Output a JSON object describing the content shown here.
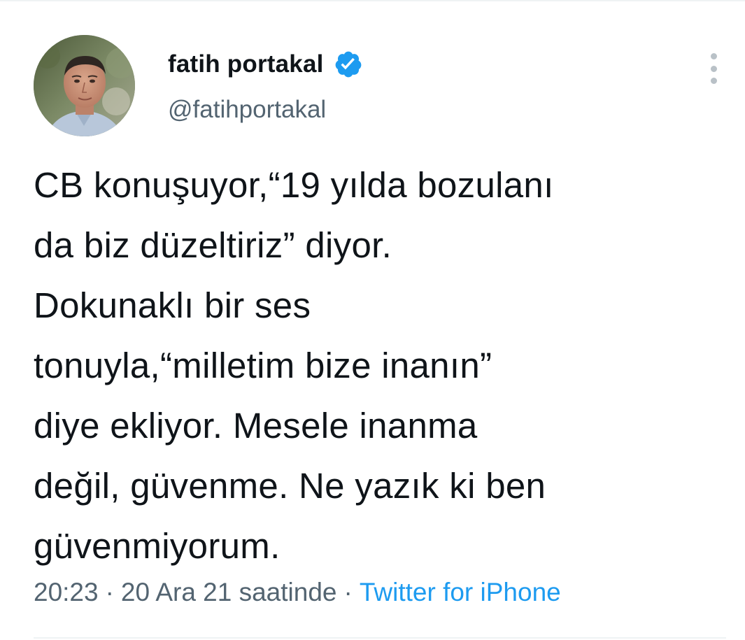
{
  "tweet": {
    "author": {
      "display_name": "fatih portakal",
      "handle": "@fatihportakal",
      "verified": true,
      "verified_icon": "verified-badge-icon",
      "avatar_icon": "avatar-photo"
    },
    "more_menu_icon": "more-vertical-icon",
    "text_lines": [
      "CB konuşuyor,“19 yılda bozulanı",
      "da biz düzeltiriz” diyor.",
      "Dokunaklı bir ses",
      "tonuyla,“milletim bize inanın”",
      "diye ekliyor. Mesele inanma",
      "değil, güvenme. Ne yazık ki ben",
      "güvenmiyorum."
    ],
    "meta": {
      "time": "20:23",
      "separator": "·",
      "date": "20 Ara 21 saatinde",
      "source": "Twitter for iPhone"
    }
  },
  "colors": {
    "text_primary": "#0f1419",
    "text_secondary": "#536471",
    "link_blue": "#1d9bf0",
    "verified_blue": "#1d9bf0",
    "divider": "#eff3f4"
  }
}
